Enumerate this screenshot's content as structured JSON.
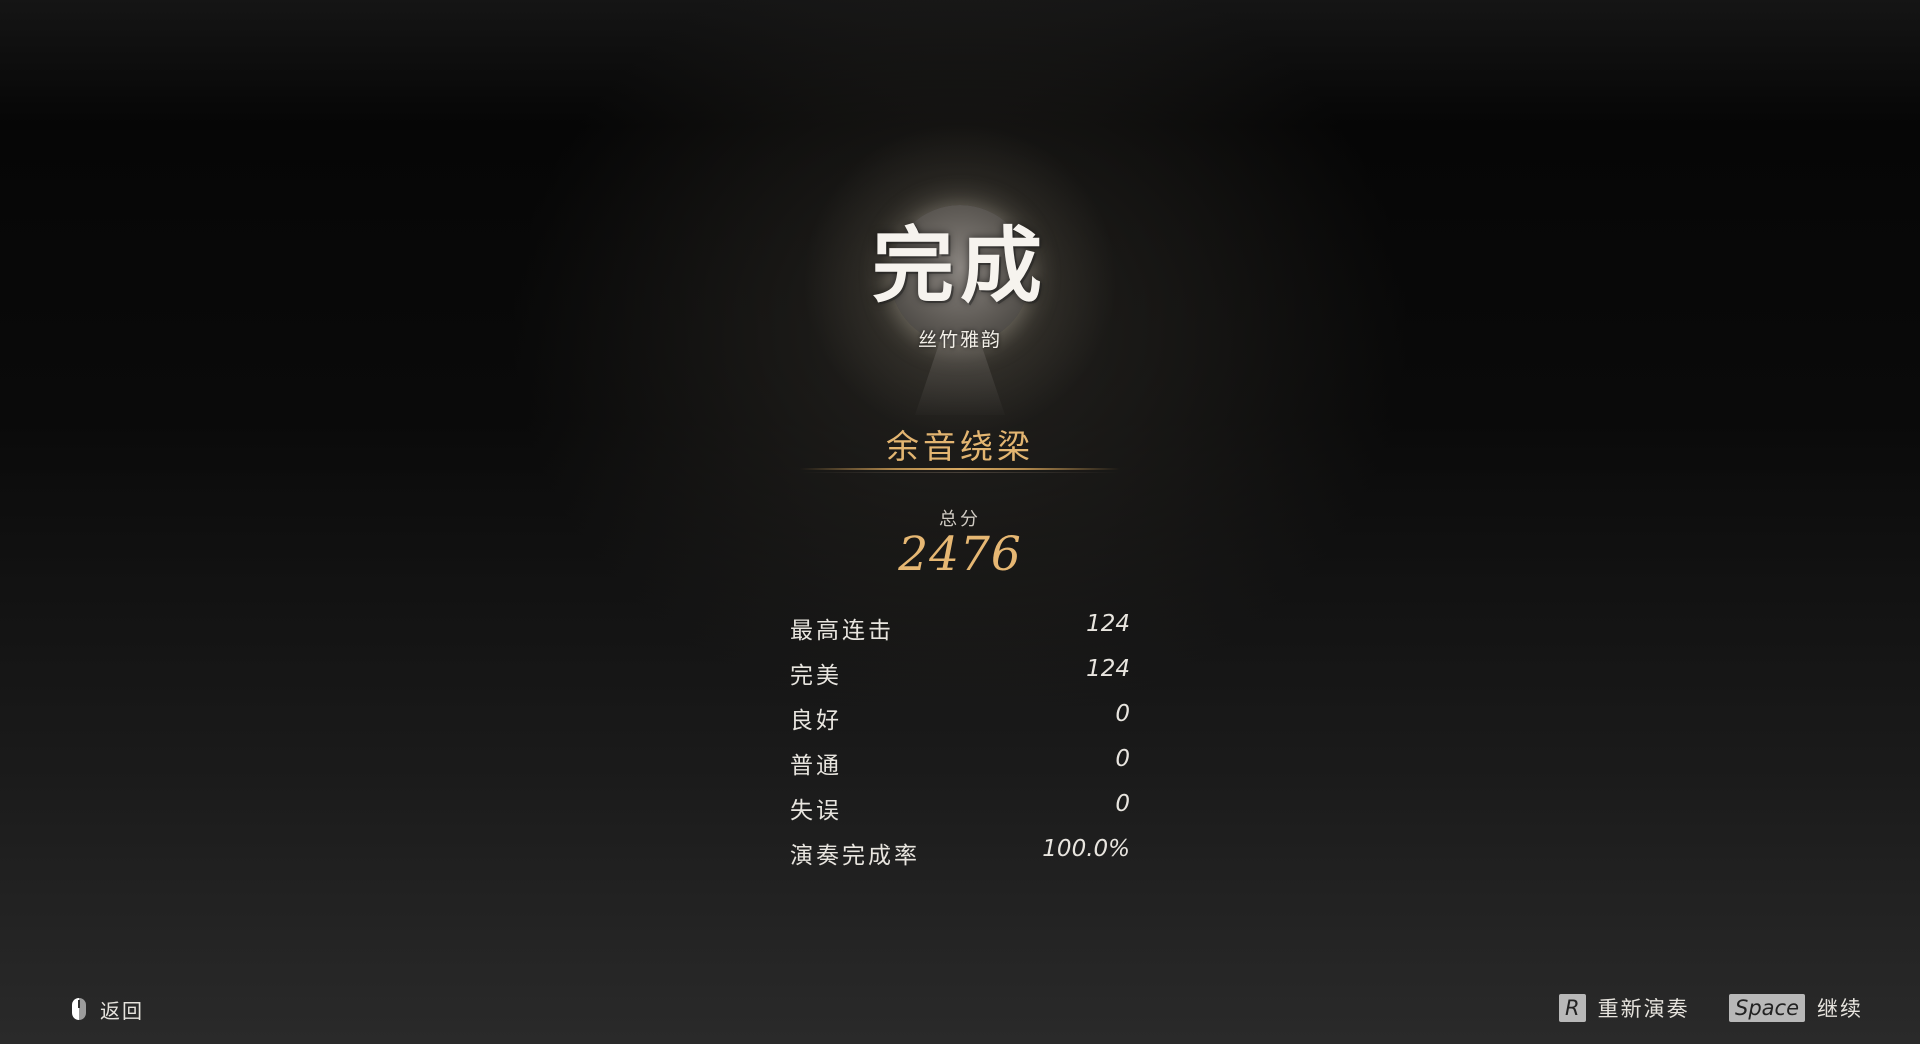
{
  "result": {
    "title": "完成",
    "song_name": "丝竹雅韵",
    "rank_title": "余音绕梁"
  },
  "score": {
    "label": "总分",
    "value": "2476"
  },
  "stats": [
    {
      "label": "最高连击",
      "value": "124"
    },
    {
      "label": "完美",
      "value": "124"
    },
    {
      "label": "良好",
      "value": "0"
    },
    {
      "label": "普通",
      "value": "0"
    },
    {
      "label": "失误",
      "value": "0"
    },
    {
      "label": "演奏完成率",
      "value": "100.0%"
    }
  ],
  "controls": {
    "back": {
      "icon": "mouse-left-click-icon",
      "label": "返回"
    },
    "replay": {
      "key": "R",
      "label": "重新演奏"
    },
    "continue": {
      "key": "Space",
      "label": "继续"
    }
  },
  "colors": {
    "accent_gold": "#e3b571",
    "text": "#e8e5df",
    "background": "#0a0a0a"
  }
}
